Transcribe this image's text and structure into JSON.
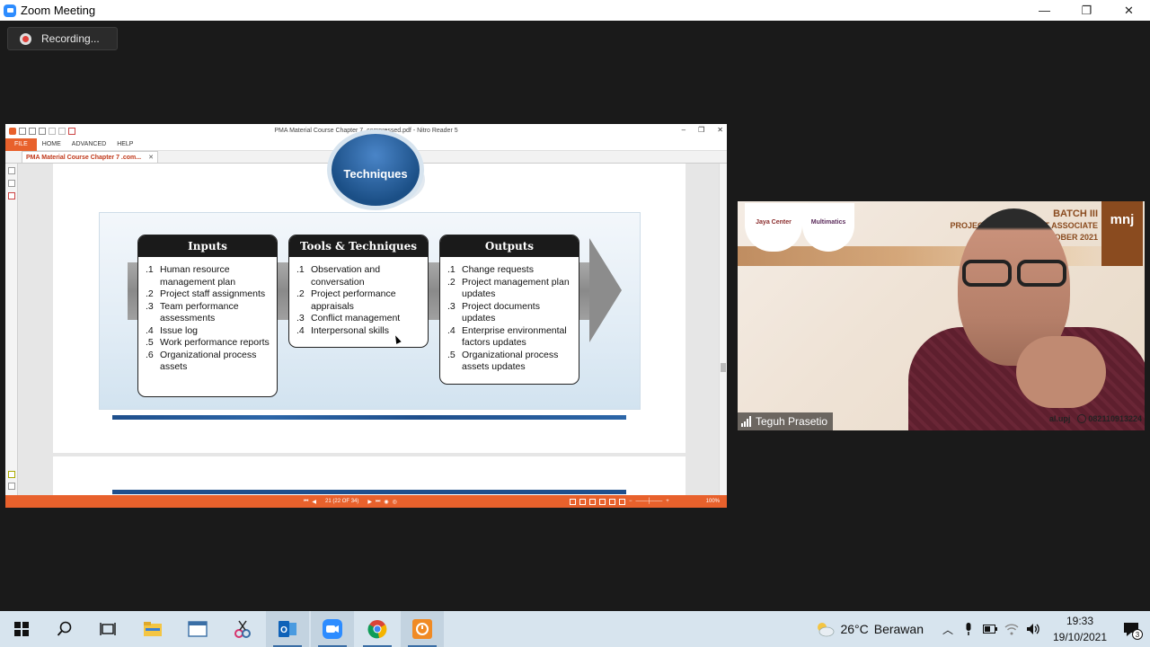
{
  "window": {
    "title": "Zoom Meeting",
    "controls": {
      "minimize": "—",
      "restore": "❐",
      "close": "✕"
    }
  },
  "recording": {
    "label": "Recording..."
  },
  "reader": {
    "doc_title": "PMA Material Course Chapter 7_compressed.pdf - Nitro Reader 5",
    "menu": [
      "FILE",
      "HOME",
      "ADVANCED",
      "HELP"
    ],
    "tab_label": "PMA Material Course Chapter 7 .com...",
    "tab_close": "✕",
    "status": {
      "page_indicator": "21 (22 OF 34)",
      "zoom": "100%"
    }
  },
  "slide": {
    "header_circle": "Techniques",
    "inputs": {
      "title": "Inputs",
      "items": [
        {
          "num": ".1",
          "text": "Human resource management plan"
        },
        {
          "num": ".2",
          "text": "Project staff assignments"
        },
        {
          "num": ".3",
          "text": "Team performance assessments"
        },
        {
          "num": ".4",
          "text": "Issue log"
        },
        {
          "num": ".5",
          "text": "Work performance reports"
        },
        {
          "num": ".6",
          "text": "Organizational process assets"
        }
      ]
    },
    "tools": {
      "title": "Tools & Techniques",
      "items": [
        {
          "num": ".1",
          "text": "Observation and conversation"
        },
        {
          "num": ".2",
          "text": "Project performance appraisals"
        },
        {
          "num": ".3",
          "text": "Conflict management"
        },
        {
          "num": ".4",
          "text": "Interpersonal skills"
        }
      ]
    },
    "outputs": {
      "title": "Outputs",
      "items": [
        {
          "num": ".1",
          "text": "Change requests"
        },
        {
          "num": ".2",
          "text": "Project management plan updates"
        },
        {
          "num": ".3",
          "text": "Project documents updates"
        },
        {
          "num": ".4",
          "text": "Enterprise environmental factors updates"
        },
        {
          "num": ".5",
          "text": "Organizational process assets updates"
        }
      ]
    }
  },
  "video": {
    "participant_name": "Teguh Prasetio",
    "banner": {
      "line1": "BATCH III",
      "line2": "PROJECT MANAGEMENT ASSOCIATE",
      "line3": "OCTOBER 2021"
    },
    "brand": "mnj",
    "logo1": "Jaya Center",
    "logo2": "Multimatics",
    "contact_social": "al.upj",
    "contact_phone": "082110913224"
  },
  "taskbar": {
    "weather": {
      "temp": "26°C",
      "condition": "Berawan"
    },
    "time": "19:33",
    "date": "19/10/2021",
    "notification_count": "3"
  },
  "colors": {
    "accent_orange": "#e8612c",
    "zoom_blue": "#2d8cff",
    "slide_blue": "#1f4f8c"
  }
}
